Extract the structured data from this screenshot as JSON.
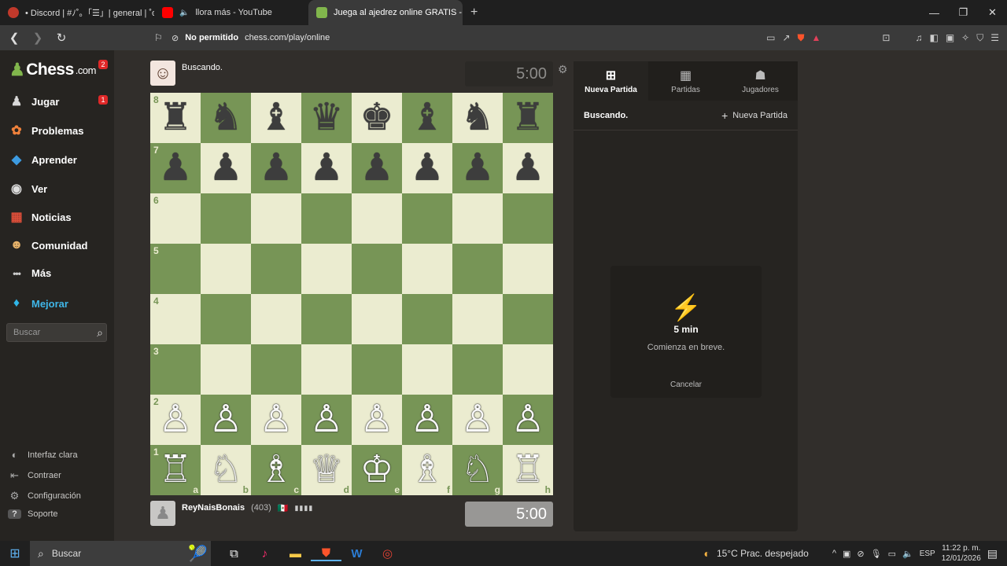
{
  "browser": {
    "tabs": [
      {
        "title": "• Discord | #ﾉ˚｡「☰」| general | ˚ɞ˚☽˚.",
        "favicon_color": "#c0392b",
        "active": false
      },
      {
        "title": "llora más - YouTube",
        "favicon_color": "#ff0000",
        "active": false
      },
      {
        "title": "Juega al ajedrez online GRATIS -",
        "favicon_color": "#81b64c",
        "active": true
      }
    ],
    "new_tab": "+",
    "permission_label": "No permitido",
    "url": "chess.com/play/online"
  },
  "sidebar": {
    "logo_text": "Chess",
    "logo_suffix": ".com",
    "logo_badge": "2",
    "items": [
      {
        "label": "Jugar",
        "icon": "play-pawn-icon",
        "glyph": "♟",
        "badge": "1"
      },
      {
        "label": "Problemas",
        "icon": "puzzle-icon",
        "glyph": "✿"
      },
      {
        "label": "Aprender",
        "icon": "learn-icon",
        "glyph": "◆"
      },
      {
        "label": "Ver",
        "icon": "binoculars-icon",
        "glyph": "◉"
      },
      {
        "label": "Noticias",
        "icon": "news-icon",
        "glyph": "▦"
      },
      {
        "label": "Comunidad",
        "icon": "community-icon",
        "glyph": "☻"
      },
      {
        "label": "Más",
        "icon": "more-dots-icon",
        "glyph": "•••"
      },
      {
        "label": "Mejorar",
        "icon": "diamond-icon",
        "glyph": "♦",
        "color": "#1baca6"
      }
    ],
    "search_placeholder": "Buscar",
    "footer": [
      {
        "label": "Interfaz clara",
        "icon": "theme-toggle-icon",
        "glyph": "◐"
      },
      {
        "label": "Contraer",
        "icon": "collapse-icon",
        "glyph": "⇤"
      },
      {
        "label": "Configuración",
        "icon": "settings-icon",
        "glyph": "⚙"
      },
      {
        "label": "Soporte",
        "icon": "help-icon",
        "glyph": "?"
      }
    ]
  },
  "game": {
    "top_player": {
      "name": "Buscando.",
      "clock": "5:00"
    },
    "bottom_player": {
      "name": "ReyNaisBonais",
      "rating": "(403)",
      "flag": "🇲🇽",
      "clock": "5:00"
    },
    "board": {
      "ranks": [
        "8",
        "7",
        "6",
        "5",
        "4",
        "3",
        "2",
        "1"
      ],
      "files": [
        "a",
        "b",
        "c",
        "d",
        "e",
        "f",
        "g",
        "h"
      ],
      "rows": [
        [
          "♜",
          "♞",
          "♝",
          "♛",
          "♚",
          "♝",
          "♞",
          "♜"
        ],
        [
          "♟",
          "♟",
          "♟",
          "♟",
          "♟",
          "♟",
          "♟",
          "♟"
        ],
        [
          "",
          "",
          "",
          "",
          "",
          "",
          "",
          ""
        ],
        [
          "",
          "",
          "",
          "",
          "",
          "",
          "",
          ""
        ],
        [
          "",
          "",
          "",
          "",
          "",
          "",
          "",
          ""
        ],
        [
          "",
          "",
          "",
          "",
          "",
          "",
          "",
          ""
        ],
        [
          "♙",
          "♙",
          "♙",
          "♙",
          "♙",
          "♙",
          "♙",
          "♙"
        ],
        [
          "♖",
          "♘",
          "♗",
          "♕",
          "♔",
          "♗",
          "♘",
          "♖"
        ]
      ],
      "light_color": "#ebecd0",
      "dark_color": "#779556"
    }
  },
  "right_panel": {
    "tabs": [
      {
        "label": "Nueva Partida",
        "icon": "plus-square-icon",
        "glyph": "⊞"
      },
      {
        "label": "Partidas",
        "icon": "board-grid-icon",
        "glyph": "▦"
      },
      {
        "label": "Jugadores",
        "icon": "players-icon",
        "glyph": "👥"
      }
    ],
    "status": "Buscando.",
    "new_game_link": "Nueva Partida",
    "seek": {
      "time": "5 min",
      "message": "Comienza en breve.",
      "cancel": "Cancelar"
    }
  },
  "taskbar": {
    "search_placeholder": "Buscar",
    "weather": "15°C  Prac. despejado",
    "language": "ESP",
    "time": "11:22 p. m.",
    "date": "12/01/2026"
  }
}
